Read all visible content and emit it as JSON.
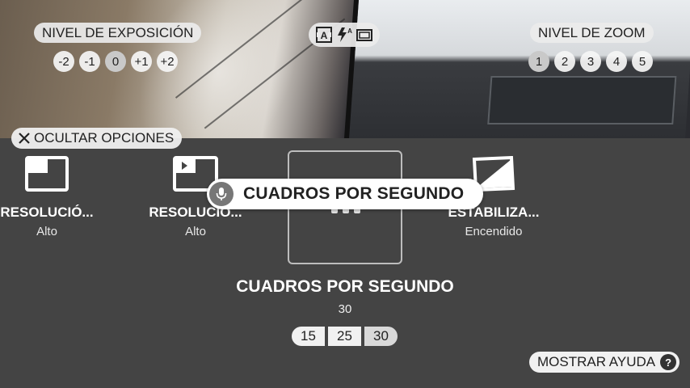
{
  "exposure": {
    "title": "NIVEL DE EXPOSICIÓN",
    "options": [
      "-2",
      "-1",
      "0",
      "+1",
      "+2"
    ],
    "selected": "0"
  },
  "zoom": {
    "title": "NIVEL DE ZOOM",
    "options": [
      "1",
      "2",
      "3",
      "4",
      "5"
    ],
    "selected": "1"
  },
  "mode_icons": [
    "auto-exposure-icon",
    "flash-auto-icon",
    "aspect-ratio-icon"
  ],
  "hide_options_label": "OCULTAR OPCIONES",
  "settings": [
    {
      "title": "RESOLUCIÓ...",
      "value": "Alto",
      "icon": "photo-resolution-icon"
    },
    {
      "title": "RESOLUCIÓ...",
      "value": "Alto",
      "icon": "video-resolution-icon"
    },
    {
      "title": "",
      "value": "",
      "icon": "fps-icon"
    },
    {
      "title": "ESTABILIZA...",
      "value": "Encendido",
      "icon": "stabilization-icon"
    }
  ],
  "tooltip": {
    "label": "CUADROS POR SEGUNDO",
    "icon": "mic-icon"
  },
  "detail": {
    "title": "CUADROS POR SEGUNDO",
    "value": "30",
    "options": [
      "15",
      "25",
      "30"
    ],
    "selected": "30"
  },
  "help_label": "MOSTRAR AYUDA",
  "help_icon_glyph": "?",
  "colors": {
    "panel_bg": "#444444",
    "pill_bg": "#ebebeb",
    "text_dark": "#222222",
    "text_light": "#ffffff"
  }
}
